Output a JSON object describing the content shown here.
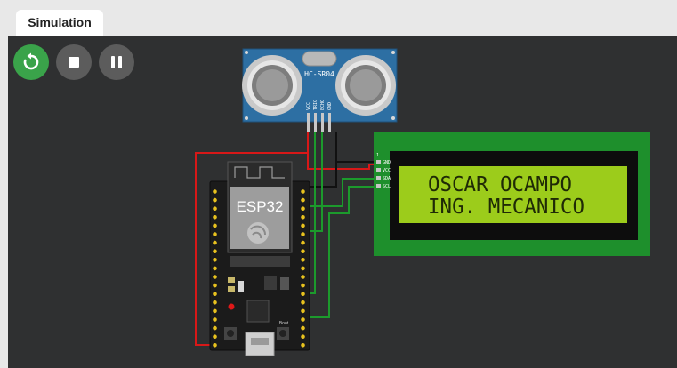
{
  "tabs": [
    {
      "label": "Simulation"
    }
  ],
  "controls": {
    "restart_icon": "restart-icon",
    "stop_icon": "stop-icon",
    "pause_icon": "pause-icon"
  },
  "sensor": {
    "label": "HC-SR04",
    "pins": [
      "VCC",
      "TRIG",
      "ECHO",
      "GND"
    ]
  },
  "mcu": {
    "label": "ESP32",
    "boot_label": "Boot"
  },
  "lcd": {
    "line1": "OSCAR OCAMPO",
    "line2": "ING. MECANICO",
    "pin_index": "1",
    "pins": [
      "GND",
      "VCC",
      "SDA",
      "SCL"
    ]
  },
  "colors": {
    "restart": "#3aa34a",
    "lcd_screen": "#9ccc1b",
    "lcd_text": "#1f2a06",
    "lcd_pcb": "#1e8f2c",
    "wire_red": "#d81818",
    "wire_black": "#111111",
    "wire_green": "#1c9a2c"
  }
}
